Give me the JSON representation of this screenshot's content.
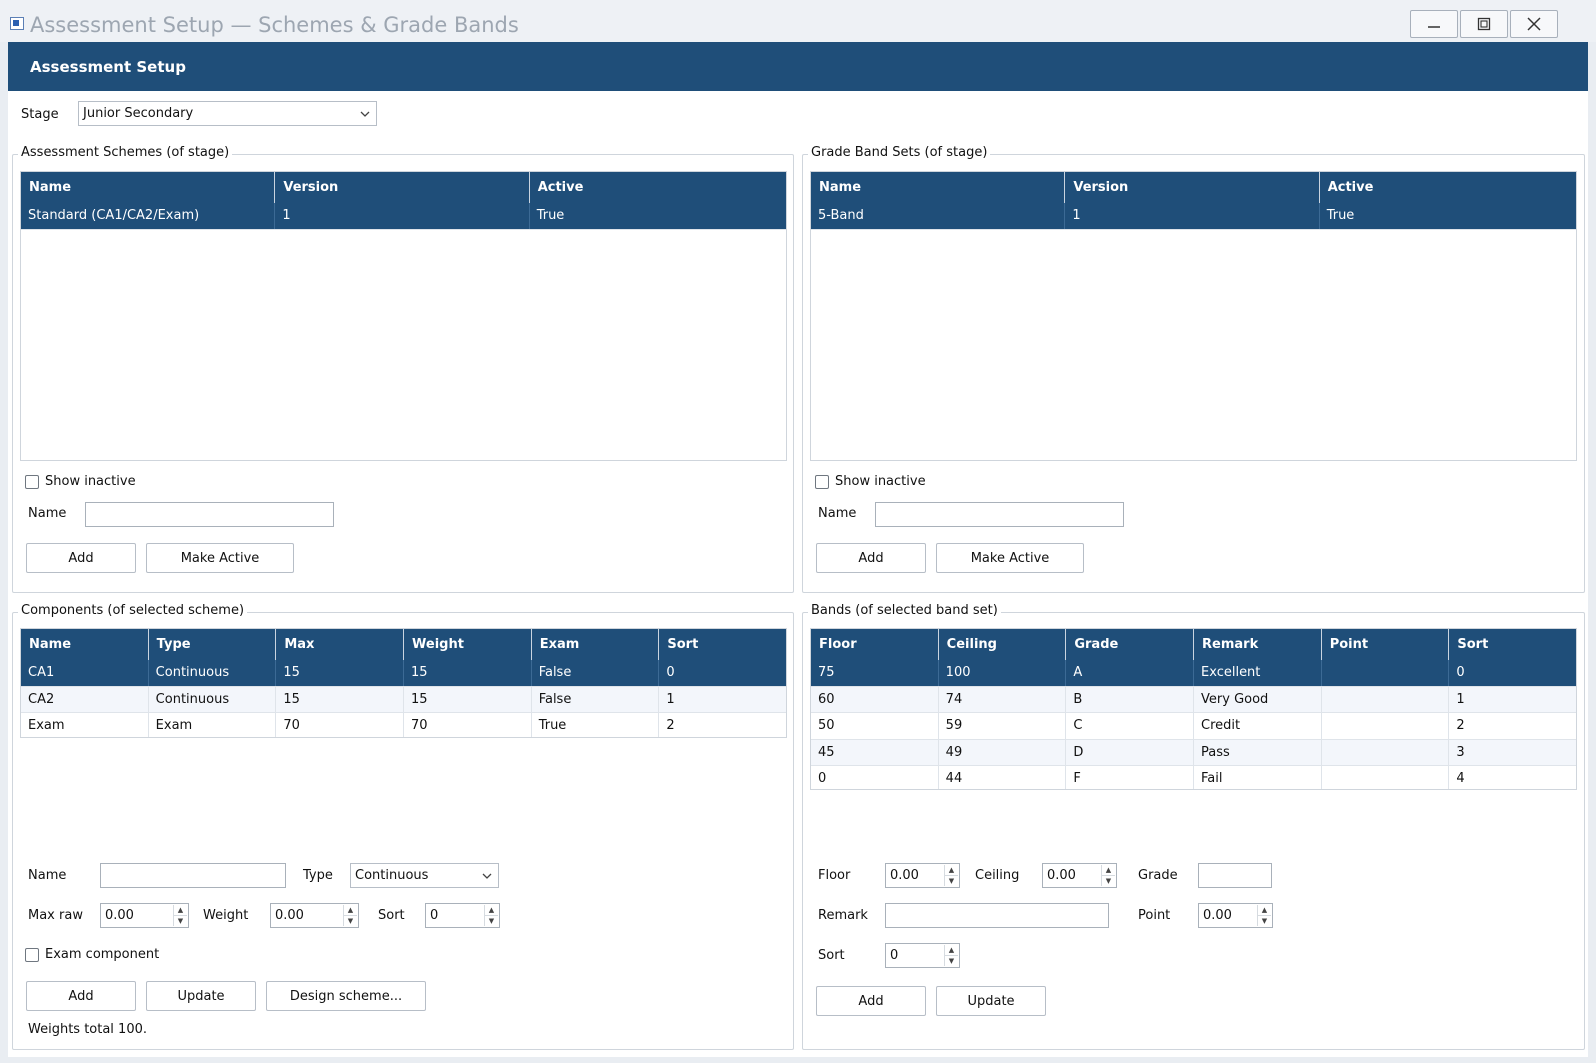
{
  "window": {
    "title": "Assessment Setup — Schemes & Grade Bands"
  },
  "header": {
    "title": "Assessment Setup"
  },
  "stage": {
    "label": "Stage",
    "value": "Junior Secondary"
  },
  "schemes": {
    "title": "Assessment Schemes (of stage)",
    "columns": [
      "Name",
      "Version",
      "Active"
    ],
    "rows": [
      [
        "Standard (CA1/CA2/Exam)",
        "1",
        "True"
      ]
    ],
    "show_inactive": "Show inactive",
    "name_label": "Name",
    "name_value": "",
    "add": "Add",
    "make_active": "Make Active"
  },
  "bandsets": {
    "title": "Grade Band Sets (of stage)",
    "columns": [
      "Name",
      "Version",
      "Active"
    ],
    "rows": [
      [
        "5-Band",
        "1",
        "True"
      ]
    ],
    "show_inactive": "Show inactive",
    "name_label": "Name",
    "name_value": "",
    "add": "Add",
    "make_active": "Make Active"
  },
  "components": {
    "title": "Components (of selected scheme)",
    "columns": [
      "Name",
      "Type",
      "Max",
      "Weight",
      "Exam",
      "Sort"
    ],
    "rows": [
      [
        "CA1",
        "Continuous",
        "15",
        "15",
        "False",
        "0"
      ],
      [
        "CA2",
        "Continuous",
        "15",
        "15",
        "False",
        "1"
      ],
      [
        "Exam",
        "Exam",
        "70",
        "70",
        "True",
        "2"
      ]
    ],
    "form": {
      "name_label": "Name",
      "name_value": "",
      "type_label": "Type",
      "type_value": "Continuous",
      "max_label": "Max raw",
      "max_value": "0.00",
      "weight_label": "Weight",
      "weight_value": "0.00",
      "sort_label": "Sort",
      "sort_value": "0",
      "exam_component": "Exam component"
    },
    "add": "Add",
    "update": "Update",
    "design": "Design scheme...",
    "status": "Weights total 100."
  },
  "bands": {
    "title": "Bands (of selected band set)",
    "columns": [
      "Floor",
      "Ceiling",
      "Grade",
      "Remark",
      "Point",
      "Sort"
    ],
    "rows": [
      [
        "75",
        "100",
        "A",
        "Excellent",
        "",
        "0"
      ],
      [
        "60",
        "74",
        "B",
        "Very Good",
        "",
        "1"
      ],
      [
        "50",
        "59",
        "C",
        "Credit",
        "",
        "2"
      ],
      [
        "45",
        "49",
        "D",
        "Pass",
        "",
        "3"
      ],
      [
        "0",
        "44",
        "F",
        "Fail",
        "",
        "4"
      ]
    ],
    "form": {
      "floor_label": "Floor",
      "floor_value": "0.00",
      "ceiling_label": "Ceiling",
      "ceiling_value": "0.00",
      "grade_label": "Grade",
      "grade_value": "",
      "remark_label": "Remark",
      "remark_value": "",
      "point_label": "Point",
      "point_value": "0.00",
      "sort_label": "Sort",
      "sort_value": "0"
    },
    "add": "Add",
    "update": "Update"
  },
  "colors": {
    "accent": "#1f4e79",
    "selected_row": "#1f4e79",
    "alt_row": "#f3f6fb"
  },
  "icons": [
    "app-icon",
    "minimize-icon",
    "maximize-icon",
    "close-icon",
    "chevron-down-icon",
    "spin-up-icon",
    "spin-down-icon"
  ]
}
